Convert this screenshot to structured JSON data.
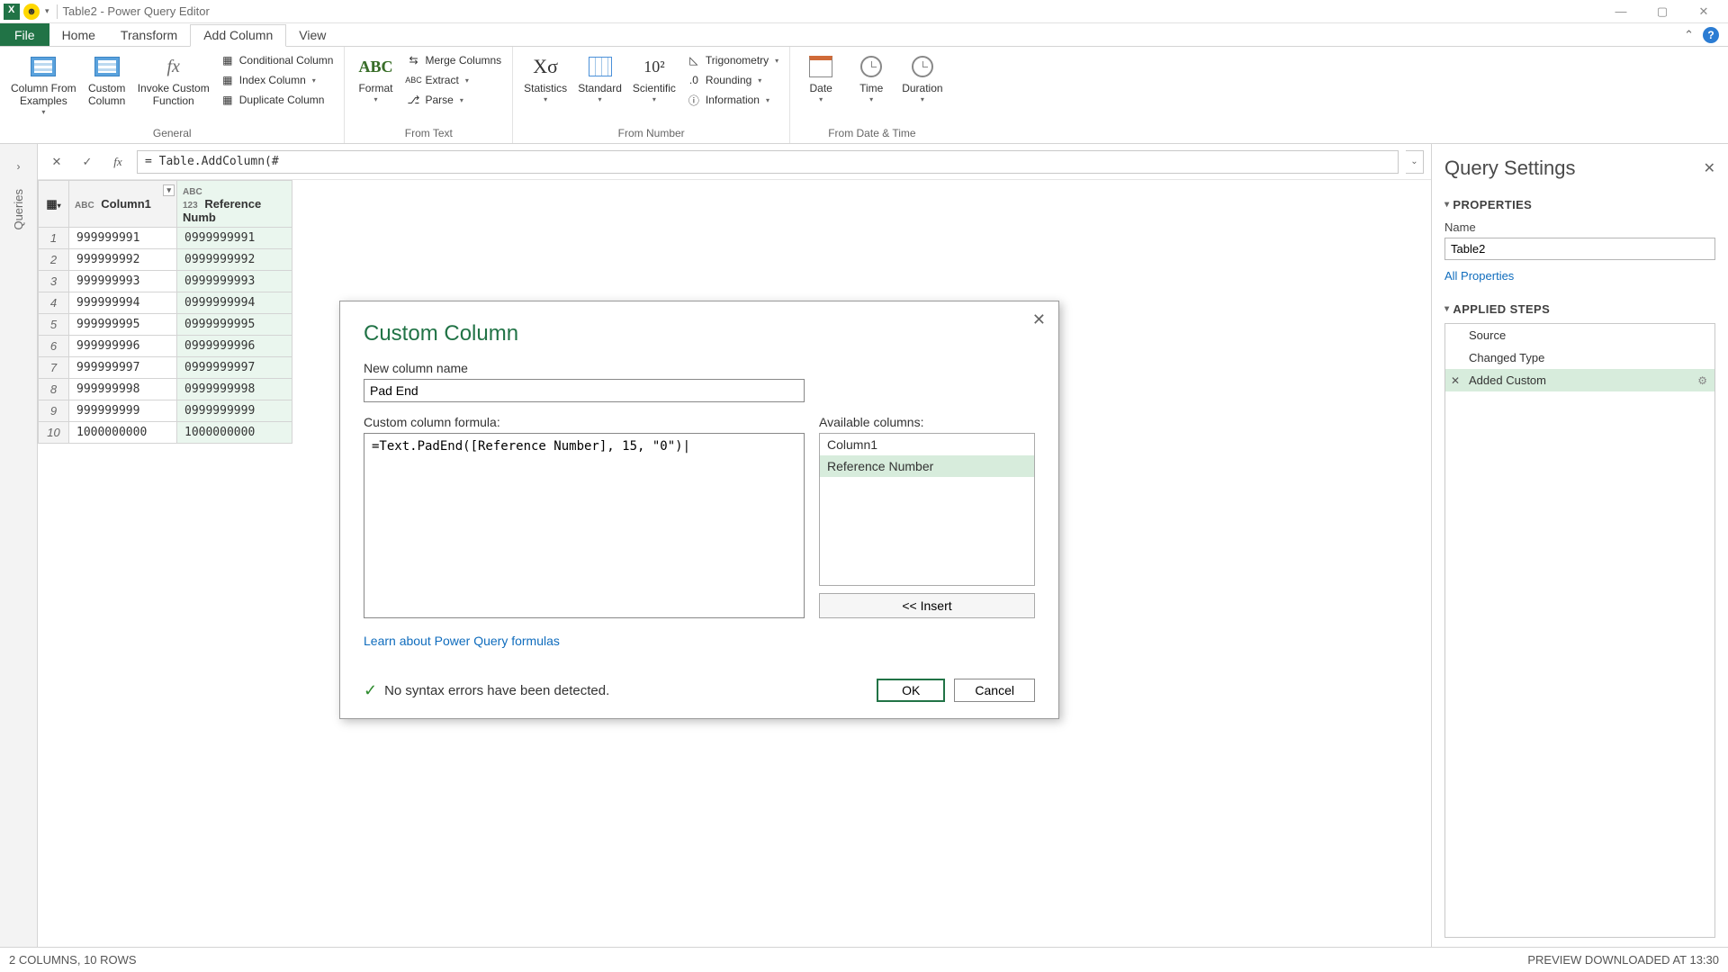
{
  "titlebar": {
    "title": "Table2 - Power Query Editor"
  },
  "window_controls": {
    "min": "—",
    "max": "▢",
    "close": "✕"
  },
  "tabs": {
    "file": "File",
    "home": "Home",
    "transform": "Transform",
    "add_column": "Add Column",
    "view": "View"
  },
  "ribbon": {
    "general": {
      "label": "General",
      "col_from_examples": "Column From\nExamples",
      "custom_column": "Custom\nColumn",
      "invoke_custom": "Invoke Custom\nFunction",
      "conditional": "Conditional Column",
      "index": "Index Column",
      "duplicate": "Duplicate Column"
    },
    "from_text": {
      "label": "From Text",
      "format": "Format",
      "merge": "Merge Columns",
      "extract": "Extract",
      "parse": "Parse"
    },
    "from_number": {
      "label": "From Number",
      "statistics": "Statistics",
      "standard": "Standard",
      "scientific": "Scientific",
      "trig": "Trigonometry",
      "rounding": "Rounding",
      "information": "Information"
    },
    "from_date_time": {
      "label": "From Date & Time",
      "date": "Date",
      "time": "Time",
      "duration": "Duration"
    }
  },
  "queries_rail": "Queries",
  "formula_bar": "= Table.AddColumn(#",
  "grid": {
    "columns": [
      "Column1",
      "Reference Numb"
    ],
    "rows": [
      {
        "n": "1",
        "c1": "999999991",
        "c2": "0999999991"
      },
      {
        "n": "2",
        "c1": "999999992",
        "c2": "0999999992"
      },
      {
        "n": "3",
        "c1": "999999993",
        "c2": "0999999993"
      },
      {
        "n": "4",
        "c1": "999999994",
        "c2": "0999999994"
      },
      {
        "n": "5",
        "c1": "999999995",
        "c2": "0999999995"
      },
      {
        "n": "6",
        "c1": "999999996",
        "c2": "0999999996"
      },
      {
        "n": "7",
        "c1": "999999997",
        "c2": "0999999997"
      },
      {
        "n": "8",
        "c1": "999999998",
        "c2": "0999999998"
      },
      {
        "n": "9",
        "c1": "999999999",
        "c2": "0999999999"
      },
      {
        "n": "10",
        "c1": "1000000000",
        "c2": "1000000000"
      }
    ]
  },
  "settings": {
    "title": "Query Settings",
    "properties": "PROPERTIES",
    "name_label": "Name",
    "name_value": "Table2",
    "all_properties": "All Properties",
    "applied_steps": "APPLIED STEPS",
    "steps": [
      "Source",
      "Changed Type",
      "Added Custom"
    ]
  },
  "dialog": {
    "title": "Custom Column",
    "name_label": "New column name",
    "name_value": "Pad End",
    "formula_label": "Custom column formula:",
    "formula_value": "=Text.PadEnd([Reference Number], 15, \"0\")",
    "available_label": "Available columns:",
    "available": [
      "Column1",
      "Reference Number"
    ],
    "insert": "<< Insert",
    "learn": "Learn about Power Query formulas",
    "status": "No syntax errors have been detected.",
    "ok": "OK",
    "cancel": "Cancel"
  },
  "statusbar": {
    "left": "2 COLUMNS, 10 ROWS",
    "right": "PREVIEW DOWNLOADED AT 13:30"
  }
}
